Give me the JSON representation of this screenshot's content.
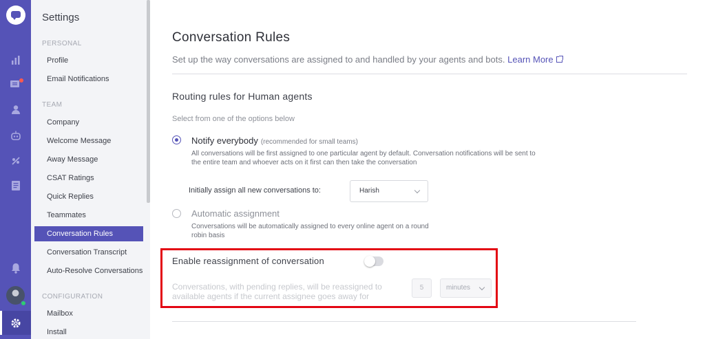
{
  "rail": {
    "icons": [
      "logo-icon",
      "reports-icon",
      "conversations-icon",
      "contacts-icon",
      "bot-icon",
      "integrations-icon",
      "faq-icon",
      "notifications-icon",
      "avatar",
      "settings-icon"
    ]
  },
  "sidebar": {
    "title": "Settings",
    "sections": [
      {
        "label": "PERSONAL",
        "items": [
          "Profile",
          "Email Notifications"
        ]
      },
      {
        "label": "TEAM",
        "items": [
          "Company",
          "Welcome Message",
          "Away Message",
          "CSAT Ratings",
          "Quick Replies",
          "Teammates",
          "Conversation Rules",
          "Conversation Transcript",
          "Auto-Resolve Conversations"
        ]
      },
      {
        "label": "CONFIGURATION",
        "items": [
          "Mailbox",
          "Install"
        ]
      }
    ],
    "active_item": "Conversation Rules"
  },
  "main": {
    "title": "Conversation Rules",
    "subtitle": "Set up the way conversations are assigned to and handled by your agents and bots.",
    "learn_more": "Learn More",
    "routing": {
      "title": "Routing rules for Human agents",
      "hint": "Select from one of the options below",
      "options": [
        {
          "title": "Notify everybody",
          "note": "(recommended for small teams)",
          "desc_1": "All conversations will be first assigned to one particular agent by default. Conversation notifications will be sent to",
          "desc_2": "the entire team and whoever acts on it first can then take the conversation",
          "selected": true
        },
        {
          "title": "Automatic assignment",
          "desc_1": "Conversations will be automatically assigned to every online agent on a round",
          "desc_2": "robin basis",
          "selected": false
        }
      ],
      "assign_label": "Initially assign all new conversations to:",
      "assign_value": "Harish"
    },
    "reassignment": {
      "title": "Enable reassignment of conversation",
      "enabled": false,
      "desc_1": "Conversations, with pending replies, will be reassigned to",
      "desc_2": "available agents if the current assignee goes away for",
      "number": "5",
      "unit": "minutes"
    }
  },
  "colors": {
    "accent": "#5553b7",
    "highlight_border": "#e30613",
    "notification_dot": "#ff5a4e",
    "online": "#2ecc71"
  }
}
